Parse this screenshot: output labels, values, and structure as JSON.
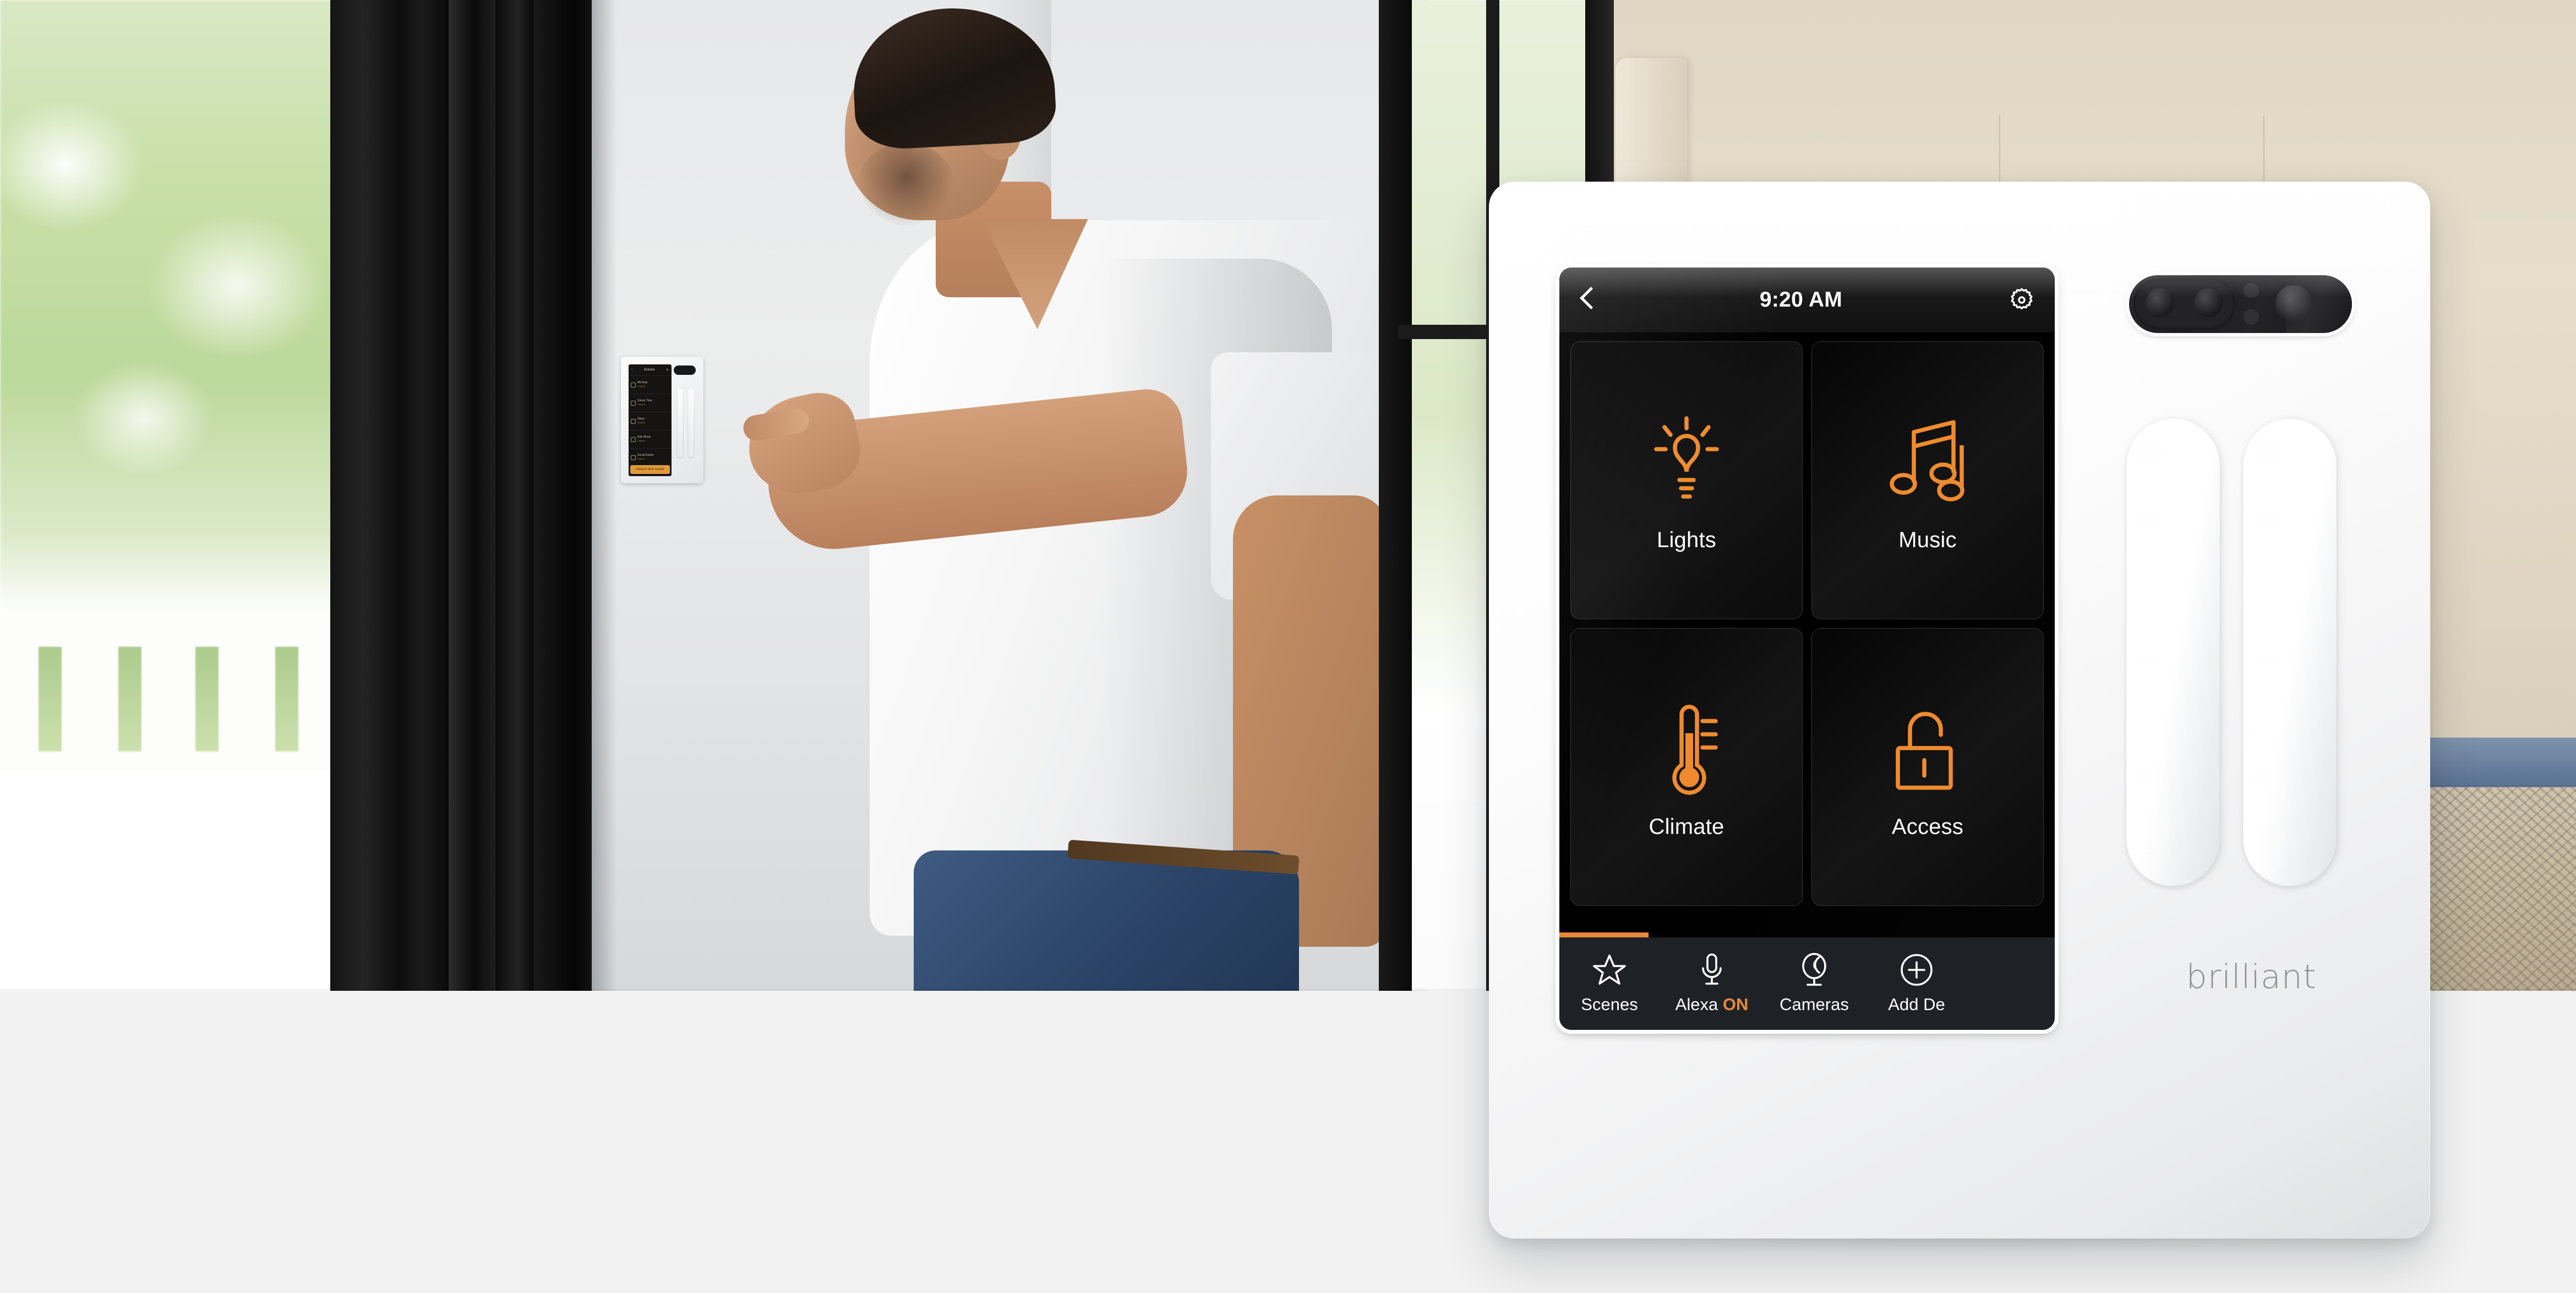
{
  "scene": {
    "description": "Man in white v-neck t-shirt touching a wall-mounted Brilliant smart home control panel in a bright room; large product render of the Brilliant 2-switch panel overlaid at right",
    "page_background": "#f2f2f2"
  },
  "device": {
    "brand": "brilliant",
    "body_color": "#ffffff",
    "accent_color": "#e8883a",
    "screen_background": "#000000",
    "navbar_background": "#1e2226",
    "camera_pod": {
      "name": "camera-module"
    },
    "sliders": [
      {
        "name": "dimmer-slider-left"
      },
      {
        "name": "dimmer-slider-right"
      }
    ]
  },
  "screen": {
    "topbar": {
      "back_icon": "back-chevron-icon",
      "clock": "9:20 AM",
      "settings_icon": "gear-icon"
    },
    "tiles": [
      {
        "label": "Lights",
        "icon": "lightbulb-icon"
      },
      {
        "label": "Music",
        "icon": "music-note-icon"
      },
      {
        "label": "Climate",
        "icon": "thermometer-icon"
      },
      {
        "label": "Access",
        "icon": "unlocked-padlock-icon"
      }
    ],
    "page_indicator": {
      "fill_percent": 18,
      "color": "#e8883a"
    },
    "navbar": [
      {
        "label": "Scenes",
        "icon": "star-icon",
        "status": ""
      },
      {
        "label": "Alexa",
        "icon": "microphone-icon",
        "status": "ON"
      },
      {
        "label": "Cameras",
        "icon": "camera-icon",
        "status": ""
      },
      {
        "label": "Add De",
        "icon": "plus-circle-icon",
        "status": ""
      }
    ]
  },
  "wall_switch": {
    "header": {
      "back_icon": "back-chevron-icon",
      "title": "Scenes",
      "edit_icon": "pencil-icon"
    },
    "rows": [
      {
        "label": "Morning",
        "sub": "Custom"
      },
      {
        "label": "Dinner Time",
        "sub": "Custom"
      },
      {
        "label": "Sleep",
        "sub": "Custom"
      },
      {
        "label": "Kids Music",
        "sub": "Custom"
      },
      {
        "label": "Social Dinner",
        "sub": "Custom"
      }
    ],
    "cta": "CREATE NEW SCENE"
  }
}
